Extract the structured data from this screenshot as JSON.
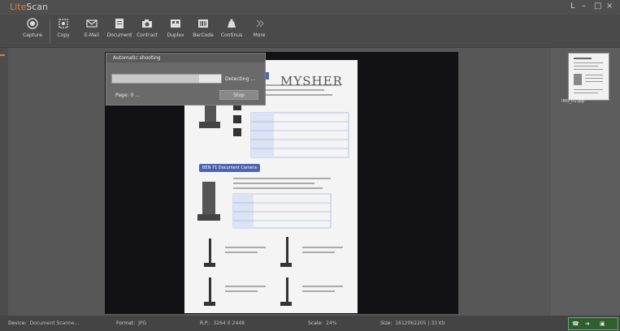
{
  "app": {
    "title_part1": "Lite",
    "title_part2": "Scan"
  },
  "window_controls": {
    "help": "L",
    "minimize": "–",
    "restore": "□",
    "close": "×"
  },
  "toolbar": {
    "items": [
      {
        "label": "Capture",
        "icon": "capture-icon"
      },
      {
        "label": "Copy",
        "icon": "copy-icon"
      },
      {
        "label": "E-Mail",
        "icon": "email-icon"
      },
      {
        "label": "Document",
        "icon": "document-icon"
      },
      {
        "label": "Contract",
        "icon": "camera-icon"
      },
      {
        "label": "Duplex",
        "icon": "duplex-icon"
      },
      {
        "label": "BarCode",
        "icon": "barcode-icon"
      },
      {
        "label": "Continus",
        "icon": "continuous-icon"
      },
      {
        "label": "More",
        "icon": "more-icon"
      }
    ]
  },
  "dialog": {
    "title": "Automatic shooting",
    "progress": 0.8,
    "detecting_text": "Detecting ...",
    "page_label": "Page:  0  ...",
    "stop_label": "Stop"
  },
  "preview": {
    "brand_text": "MYSHER",
    "section_label": "BEN 71 Document Camera"
  },
  "thumbnail": {
    "name": "IMG_01.jpg"
  },
  "status": {
    "device_label": "Device:",
    "device_value": "Document Scanne...",
    "format_label": "Format:",
    "format_value": "JPG",
    "rp_label": "R.P.:",
    "rp_value": "3264 X 2448",
    "scale_label": "Scale:",
    "scale_value": "24%",
    "size_label": "Size:",
    "size_value": "1612062205 | 33 Kb"
  },
  "colors": {
    "accent": "#e87a2a",
    "badge": "#2f5f2f"
  }
}
